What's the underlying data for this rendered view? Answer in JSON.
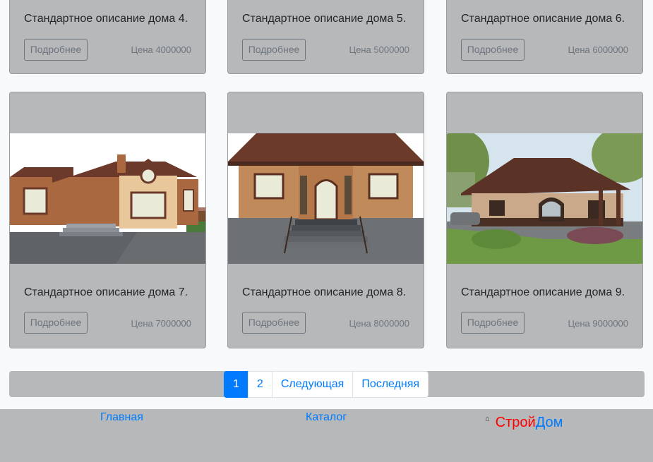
{
  "colors": {
    "card_bg": "#b7b8ba",
    "link": "#007bff",
    "brand_red": "#ff0000",
    "brand_blue": "#007bff"
  },
  "top_cards": [
    {
      "description": "Стандартное описание дома 4.",
      "button": "Подробнее",
      "price": "Цена 4000000"
    },
    {
      "description": "Стандартное описание дома 5.",
      "button": "Подробнее",
      "price": "Цена 5000000"
    },
    {
      "description": "Стандартное описание дома 6.",
      "button": "Подробнее",
      "price": "Цена 6000000"
    }
  ],
  "cards": [
    {
      "description": "Стандартное описание дома 7.",
      "button": "Подробнее",
      "price": "Цена 7000000",
      "image": "house-photo"
    },
    {
      "description": "Стандартное описание дома 8.",
      "button": "Подробнее",
      "price": "Цена 8000000",
      "image": "house-photo"
    },
    {
      "description": "Стандартное описание дома 9.",
      "button": "Подробнее",
      "price": "Цена 9000000",
      "image": "house-photo"
    }
  ],
  "pagination": {
    "pages": [
      "1",
      "2"
    ],
    "active": "1",
    "next": "Следующая",
    "last": "Последняя"
  },
  "footer": {
    "links": [
      "Главная",
      "Каталог"
    ],
    "brand_icon": "house-icon",
    "brand_part1": "Строй",
    "brand_part2": "Дом",
    "brand_part1_color": "#ff0000",
    "brand_part2_color": "#007bff"
  }
}
